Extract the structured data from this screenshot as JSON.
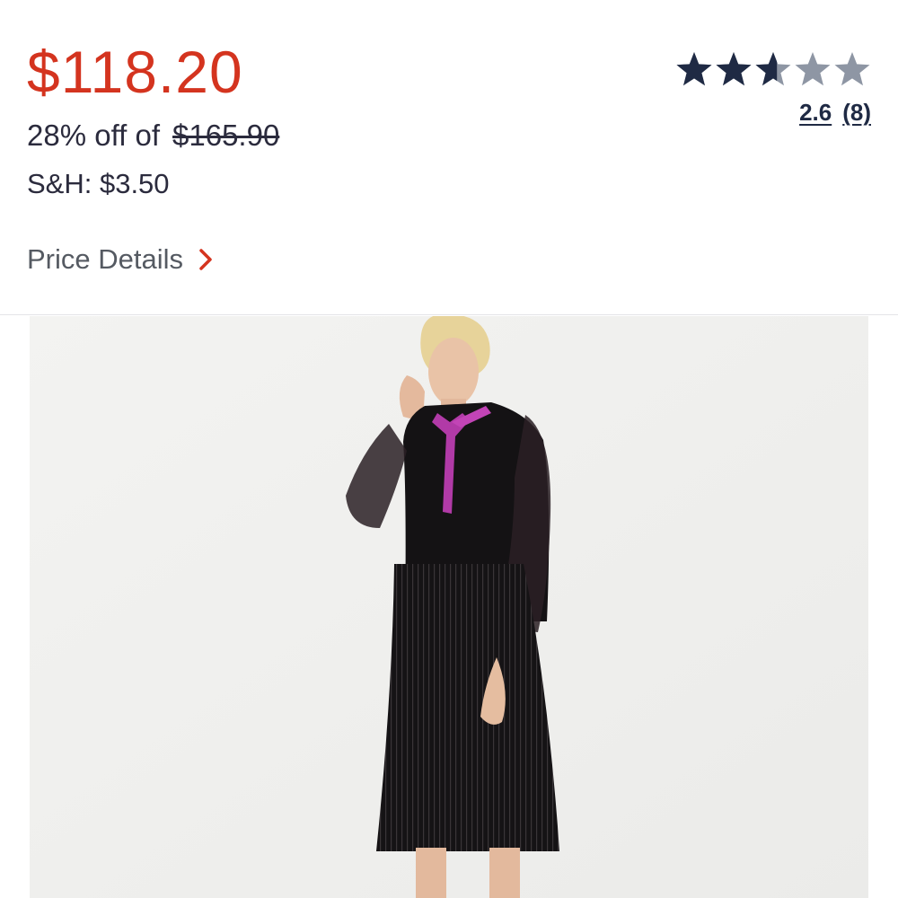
{
  "product": {
    "sale_price": "$118.20",
    "discount_text": "28% off of",
    "original_price": "$165.90",
    "shipping": "S&H: $3.50",
    "price_details_label": "Price Details",
    "rating_value": "2.6",
    "review_count": "(8)",
    "rating_stars": 2.6,
    "image_icon": "model-wearing-black-pleated-mesh-dress-with-pink-bow"
  },
  "colors": {
    "sale_price": "#d4341f",
    "text_dark": "#2b2b3d",
    "chevron": "#d4341f",
    "star_filled": "#1f2a44",
    "star_empty": "#8e96a4"
  }
}
